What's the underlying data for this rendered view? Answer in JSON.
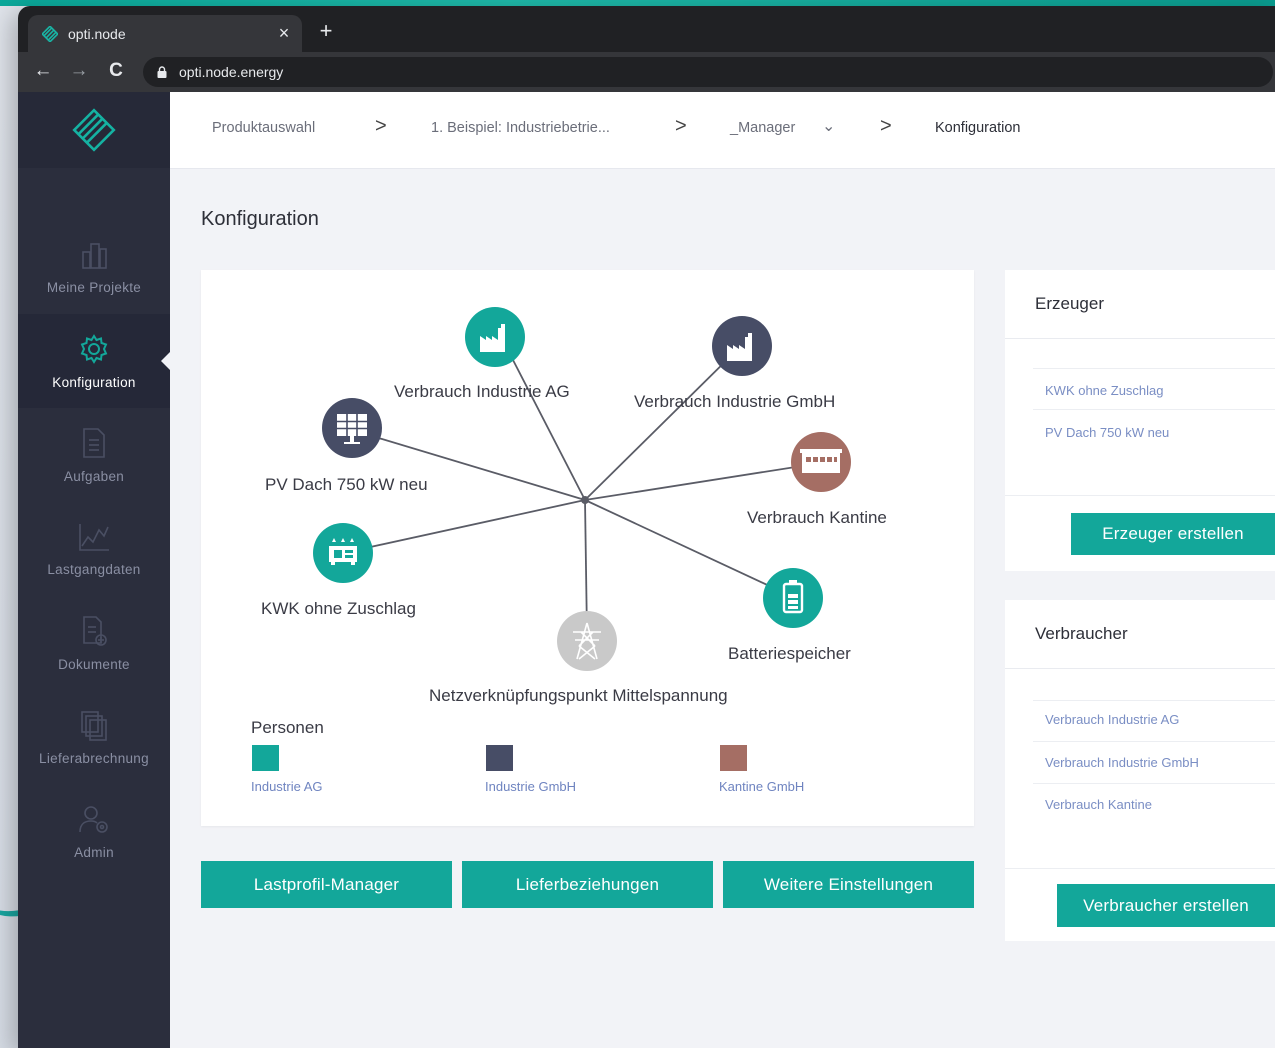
{
  "colors": {
    "teal": "#13a79a",
    "navy": "#474d66",
    "brown": "#a56e64",
    "grey": "#c9c9c9",
    "sidebar": "#2b2e3d"
  },
  "browser": {
    "tab_title": "opti.node",
    "url": "opti.node.energy",
    "close_icon": "×",
    "newtab_icon": "+",
    "back_icon": "←",
    "forward_icon": "→",
    "reload_icon": "C"
  },
  "sidebar": {
    "items": [
      {
        "label": "Meine Projekte",
        "icon": "buildings-icon"
      },
      {
        "label": "Konfiguration",
        "icon": "gear-icon"
      },
      {
        "label": "Aufgaben",
        "icon": "task-document-icon"
      },
      {
        "label": "Lastgangdaten",
        "icon": "chart-icon"
      },
      {
        "label": "Dokumente",
        "icon": "documents-icon"
      },
      {
        "label": "Lieferabrechnung",
        "icon": "invoices-icon"
      },
      {
        "label": "Admin",
        "icon": "admin-user-icon"
      }
    ]
  },
  "breadcrumb": {
    "items": [
      "Produktauswahl",
      "1. Beispiel: Industriebetrie...",
      "_Manager",
      "Konfiguration"
    ],
    "separator": ">",
    "dropdown_icon": "⌄"
  },
  "page": {
    "title": "Konfiguration"
  },
  "graph": {
    "nodes": [
      {
        "label": "Verbrauch Industrie AG",
        "color": "teal",
        "icon": "factory-icon"
      },
      {
        "label": "Verbrauch Industrie GmbH",
        "color": "navy",
        "icon": "factory-icon"
      },
      {
        "label": "PV Dach 750 kW neu",
        "color": "navy",
        "icon": "solar-panel-icon"
      },
      {
        "label": "Verbrauch Kantine",
        "color": "brown",
        "icon": "canteen-building-icon"
      },
      {
        "label": "KWK ohne Zuschlag",
        "color": "teal",
        "icon": "chp-generator-icon"
      },
      {
        "label": "Batteriespeicher",
        "color": "teal",
        "icon": "battery-icon"
      },
      {
        "label": "Netzverknüpfungspunkt Mittelspannung",
        "color": "grey",
        "icon": "power-pylon-icon"
      }
    ],
    "legend": {
      "title": "Personen",
      "items": [
        {
          "label": "Industrie AG",
          "color": "#13a79a"
        },
        {
          "label": "Industrie GmbH",
          "color": "#474d66"
        },
        {
          "label": "Kantine GmbH",
          "color": "#a56e64"
        }
      ]
    }
  },
  "buttons": {
    "lastprofil": "Lastprofil-Manager",
    "lieferbeziehungen": "Lieferbeziehungen",
    "einstellungen": "Weitere Einstellungen"
  },
  "erzeuger": {
    "title": "Erzeuger",
    "items": [
      "KWK ohne Zuschlag",
      "PV Dach 750 kW neu"
    ],
    "button": "Erzeuger erstellen"
  },
  "verbraucher": {
    "title": "Verbraucher",
    "items": [
      "Verbrauch Industrie AG",
      "Verbrauch Industrie GmbH",
      "Verbrauch Kantine"
    ],
    "button": "Verbraucher erstellen"
  }
}
